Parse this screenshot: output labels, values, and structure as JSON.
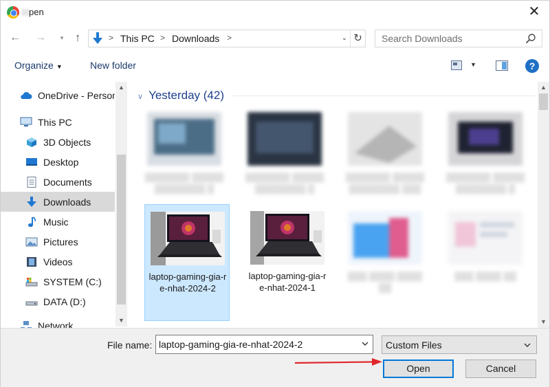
{
  "window": {
    "title": "pen"
  },
  "address": {
    "crumbs": [
      "This PC",
      "Downloads"
    ],
    "separators": [
      ">",
      ">",
      ">"
    ]
  },
  "search": {
    "placeholder": "Search Downloads"
  },
  "toolbar": {
    "organize": "Organize",
    "new_folder": "New folder",
    "help": "?"
  },
  "nav": {
    "items": [
      {
        "label": "OneDrive - Person",
        "icon": "cloud-icon"
      },
      {
        "label": "This PC",
        "icon": "computer-icon"
      },
      {
        "label": "3D Objects",
        "icon": "cube-icon"
      },
      {
        "label": "Desktop",
        "icon": "desktop-icon"
      },
      {
        "label": "Documents",
        "icon": "document-icon"
      },
      {
        "label": "Downloads",
        "icon": "download-arrow-icon",
        "selected": true
      },
      {
        "label": "Music",
        "icon": "music-note-icon"
      },
      {
        "label": "Pictures",
        "icon": "pictures-icon"
      },
      {
        "label": "Videos",
        "icon": "film-icon"
      },
      {
        "label": "SYSTEM (C:)",
        "icon": "system-drive-icon"
      },
      {
        "label": "DATA (D:)",
        "icon": "drive-icon"
      },
      {
        "label": "Network",
        "icon": "network-icon"
      }
    ]
  },
  "content": {
    "group_header": "Yesterday (42)",
    "files": [
      {
        "caption": "laptop-gaming-gia-re-nhat-2024-2",
        "selected": true
      },
      {
        "caption": "laptop-gaming-gia-re-nhat-2024-1",
        "selected": false
      }
    ]
  },
  "footer": {
    "file_name_label": "File name:",
    "file_name_value": "laptop-gaming-gia-re-nhat-2024-2",
    "file_type": "Custom Files",
    "open": "Open",
    "cancel": "Cancel"
  },
  "colors": {
    "accent": "#0078d7",
    "selection": "#cce8ff",
    "arrow": "#e0262b",
    "header": "#1e3f8f"
  }
}
